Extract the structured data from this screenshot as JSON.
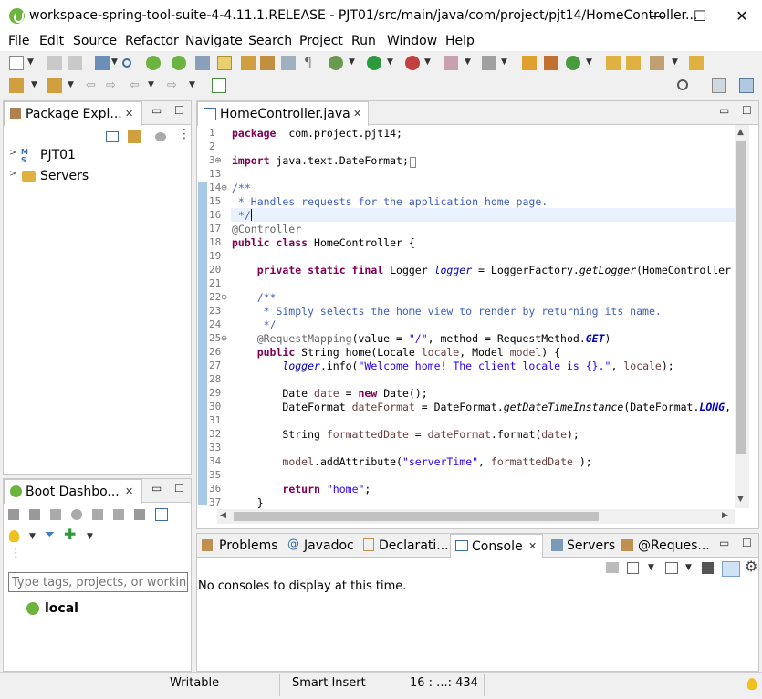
{
  "window": {
    "title": "workspace-spring-tool-suite-4-4.11.1.RELEASE - PJT01/src/main/java/com/project/pjt14/HomeController...",
    "minimize": "—",
    "maximize": "☐",
    "close": "✕"
  },
  "menu": [
    "File",
    "Edit",
    "Source",
    "Refactor",
    "Navigate",
    "Search",
    "Project",
    "Run",
    "Window",
    "Help"
  ],
  "package_explorer": {
    "tab_label": "Package Expl...",
    "items": [
      "PJT01",
      "Servers"
    ]
  },
  "boot_dashboard": {
    "tab_label": "Boot Dashbo...",
    "filter_placeholder": "Type tags, projects, or working",
    "items": [
      "local"
    ]
  },
  "editor": {
    "tab_label": "HomeController.java",
    "lines": [
      {
        "n": "1",
        "parts": [
          [
            "kw",
            "package"
          ],
          [
            "",
            "  com.project.pjt14;"
          ]
        ]
      },
      {
        "n": "2",
        "parts": []
      },
      {
        "n": "3⊕",
        "parts": [
          [
            "kw",
            "import"
          ],
          [
            "",
            " java.text.DateFormat;"
          ],
          [
            "box",
            "□"
          ]
        ]
      },
      {
        "n": "13",
        "parts": []
      },
      {
        "n": "14⊖",
        "parts": [
          [
            "cm",
            "/**"
          ]
        ]
      },
      {
        "n": "15",
        "parts": [
          [
            "cm",
            " * Handles requests for the application home page."
          ]
        ]
      },
      {
        "n": "16",
        "parts": [
          [
            "cm",
            " */"
          ]
        ]
      },
      {
        "n": "17",
        "parts": [
          [
            "an",
            "@Controller"
          ]
        ]
      },
      {
        "n": "18",
        "parts": [
          [
            "kw",
            "public class"
          ],
          [
            "",
            " HomeController {"
          ]
        ]
      },
      {
        "n": "19",
        "parts": []
      },
      {
        "n": "20",
        "parts": [
          [
            "",
            "    "
          ],
          [
            "kw",
            "private static final"
          ],
          [
            "",
            " Logger "
          ],
          [
            "fld",
            "logger"
          ],
          [
            "",
            " = LoggerFactory."
          ],
          [
            "it",
            "getLogger"
          ],
          [
            "",
            "(HomeController"
          ]
        ]
      },
      {
        "n": "21",
        "parts": []
      },
      {
        "n": "22⊖",
        "parts": [
          [
            "cm",
            "    /**"
          ]
        ]
      },
      {
        "n": "23",
        "parts": [
          [
            "cm",
            "     * Simply selects the home view to render by returning its name."
          ]
        ]
      },
      {
        "n": "24",
        "parts": [
          [
            "cm",
            "     */"
          ]
        ]
      },
      {
        "n": "25⊖",
        "parts": [
          [
            "",
            "    "
          ],
          [
            "an",
            "@RequestMapping"
          ],
          [
            "",
            "(value = "
          ],
          [
            "st",
            "\"/\""
          ],
          [
            "",
            ", method = RequestMethod."
          ],
          [
            "sf",
            "GET"
          ],
          [
            "",
            ")"
          ]
        ]
      },
      {
        "n": "26",
        "parts": [
          [
            "",
            "    "
          ],
          [
            "kw",
            "public"
          ],
          [
            "",
            " String home(Locale "
          ],
          [
            "var",
            "locale"
          ],
          [
            "",
            ", Model "
          ],
          [
            "var",
            "model"
          ],
          [
            "",
            ") {"
          ]
        ]
      },
      {
        "n": "27",
        "parts": [
          [
            "",
            "        "
          ],
          [
            "fld",
            "logger"
          ],
          [
            "",
            ".info("
          ],
          [
            "st",
            "\"Welcome home! The client locale is {}.\""
          ],
          [
            "",
            ", "
          ],
          [
            "var",
            "locale"
          ],
          [
            "",
            ");"
          ]
        ]
      },
      {
        "n": "28",
        "parts": []
      },
      {
        "n": "29",
        "parts": [
          [
            "",
            "        Date "
          ],
          [
            "var",
            "date"
          ],
          [
            "",
            " = "
          ],
          [
            "kw",
            "new"
          ],
          [
            "",
            " Date();"
          ]
        ]
      },
      {
        "n": "30",
        "parts": [
          [
            "",
            "        DateFormat "
          ],
          [
            "var",
            "dateFormat"
          ],
          [
            "",
            " = DateFormat."
          ],
          [
            "it",
            "getDateTimeInstance"
          ],
          [
            "",
            "(DateFormat."
          ],
          [
            "sf",
            "LONG"
          ],
          [
            "",
            ","
          ]
        ]
      },
      {
        "n": "31",
        "parts": []
      },
      {
        "n": "32",
        "parts": [
          [
            "",
            "        String "
          ],
          [
            "var",
            "formattedDate"
          ],
          [
            "",
            " = "
          ],
          [
            "var",
            "dateFormat"
          ],
          [
            "",
            ".format("
          ],
          [
            "var",
            "date"
          ],
          [
            "",
            ");"
          ]
        ]
      },
      {
        "n": "33",
        "parts": []
      },
      {
        "n": "34",
        "parts": [
          [
            "",
            "        "
          ],
          [
            "var",
            "model"
          ],
          [
            "",
            ".addAttribute("
          ],
          [
            "st",
            "\"serverTime\""
          ],
          [
            "",
            ", "
          ],
          [
            "var",
            "formattedDate"
          ],
          [
            "",
            " );"
          ]
        ]
      },
      {
        "n": "35",
        "parts": []
      },
      {
        "n": "36",
        "parts": [
          [
            "",
            "        "
          ],
          [
            "kw",
            "return"
          ],
          [
            "",
            " "
          ],
          [
            "st",
            "\"home\""
          ],
          [
            "",
            ";"
          ]
        ]
      },
      {
        "n": "37",
        "parts": [
          [
            "",
            "    }"
          ]
        ]
      }
    ]
  },
  "bottom_panel": {
    "tabs": [
      "Problems",
      "Javadoc",
      "Declarati...",
      "Console",
      "Servers",
      "@Reques..."
    ],
    "active_tab": "Console",
    "message": "No consoles to display at this time."
  },
  "status": {
    "mode": "Writable",
    "insert": "Smart Insert",
    "position": "16 : ...: 434"
  },
  "colors": {
    "spring_green": "#6db33f",
    "keyword": "#7f0055",
    "comment": "#3f5fbf",
    "string": "#2a00ff",
    "current_line": "#e8f2fe"
  }
}
